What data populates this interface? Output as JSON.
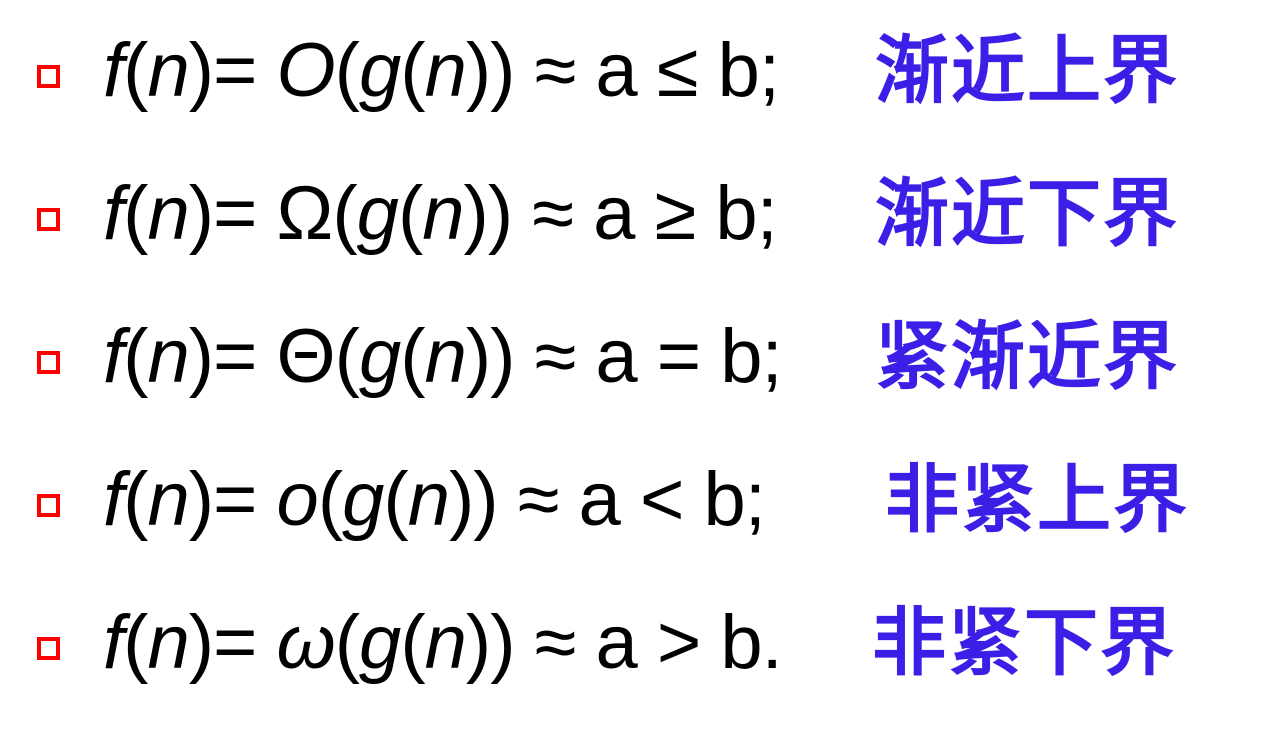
{
  "colors": {
    "bullet": "#ff0000",
    "label": "#3b1fe6",
    "text": "#000000",
    "background": "#ffffff"
  },
  "rows": [
    {
      "f": "f",
      "n1": "n",
      "paren_eq": ")= ",
      "symbol": "O",
      "g": "g",
      "n2": "n",
      "relation": ")) ≈ a ≤ b;",
      "label": "渐近上界"
    },
    {
      "f": "f",
      "n1": "n",
      "paren_eq": ")= ",
      "symbol": "Ω",
      "g": "g",
      "n2": "n",
      "relation": ")) ≈ a ≥ b;",
      "label": "渐近下界"
    },
    {
      "f": "f",
      "n1": "n",
      "paren_eq": ")= ",
      "symbol": "Θ",
      "g": "g",
      "n2": "n",
      "relation": ")) ≈ a = b;",
      "label": "紧渐近界"
    },
    {
      "f": "f",
      "n1": "n",
      "paren_eq": ")= ",
      "symbol": "o",
      "g": "g",
      "n2": "n",
      "relation": ")) ≈ a < b;",
      "label": "非紧上界"
    },
    {
      "f": "f",
      "n1": "n",
      "paren_eq": ")= ",
      "symbol": "ω",
      "g": "g",
      "n2": "n",
      "relation": ")) ≈ a > b.",
      "label": "非紧下界"
    }
  ]
}
